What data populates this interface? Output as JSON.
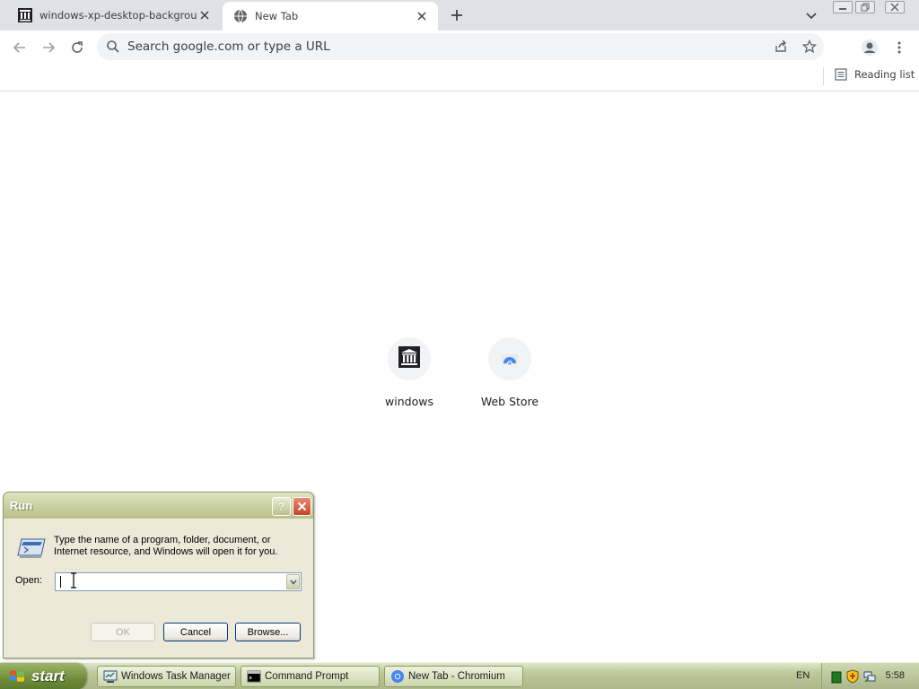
{
  "browser": {
    "tabs": [
      {
        "title": "windows-xp-desktop-background-w",
        "icon": "museum-icon",
        "active": false
      },
      {
        "title": "New Tab",
        "icon": "globe-icon",
        "active": true
      }
    ],
    "omnibox": {
      "placeholder": "Search google.com or type a URL"
    },
    "bookmarks_bar": {
      "reading_list": "Reading list"
    }
  },
  "new_tab": {
    "shortcuts": [
      {
        "label": "windows",
        "icon": "museum-icon"
      },
      {
        "label": "Web Store",
        "icon": "web-store-icon"
      }
    ]
  },
  "run_dialog": {
    "title": "Run",
    "help_glyph": "?",
    "description": "Type the name of a program, folder, document, or Internet resource, and Windows will open it for you.",
    "open_label": "Open:",
    "open_value": "",
    "buttons": {
      "ok": "OK",
      "cancel": "Cancel",
      "browse": "Browse..."
    }
  },
  "taskbar": {
    "start_label": "start",
    "tasks": [
      {
        "label": "Windows Task Manager",
        "icon": "task-manager-icon"
      },
      {
        "label": "Command Prompt",
        "icon": "cmd-icon"
      },
      {
        "label": "New Tab - Chromium",
        "icon": "chromium-icon"
      }
    ],
    "language": "EN",
    "clock": "5:58"
  },
  "colors": {
    "tabstrip": "#dee1e6",
    "omnibox": "#f1f3f4",
    "xp_dialog": "#ece9d8",
    "xp_title": "#c6cd9d",
    "taskbar": "#bcc79a",
    "start_button": "#6f8c3a"
  }
}
